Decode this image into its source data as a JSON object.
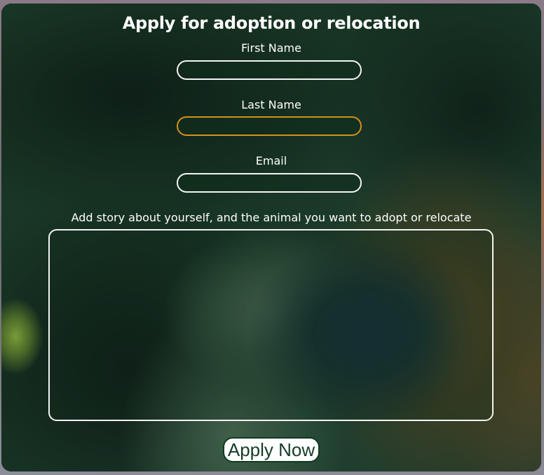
{
  "form": {
    "title": "Apply for adoption or relocation",
    "fields": {
      "first_name": {
        "label": "First Name",
        "value": "",
        "placeholder": ""
      },
      "last_name": {
        "label": "Last Name",
        "value": "",
        "placeholder": ""
      },
      "email": {
        "label": "Email",
        "value": "",
        "placeholder": ""
      }
    },
    "story": {
      "label": "Add story about yourself, and the animal you want to adopt or relocate",
      "value": ""
    },
    "submit_label": "Apply Now"
  },
  "colors": {
    "panel_tint": "#12301f",
    "input_border": "#f4f4f4",
    "focused_border": "#d3901c",
    "button_bg": "#ffffff",
    "button_text": "#153d26"
  }
}
